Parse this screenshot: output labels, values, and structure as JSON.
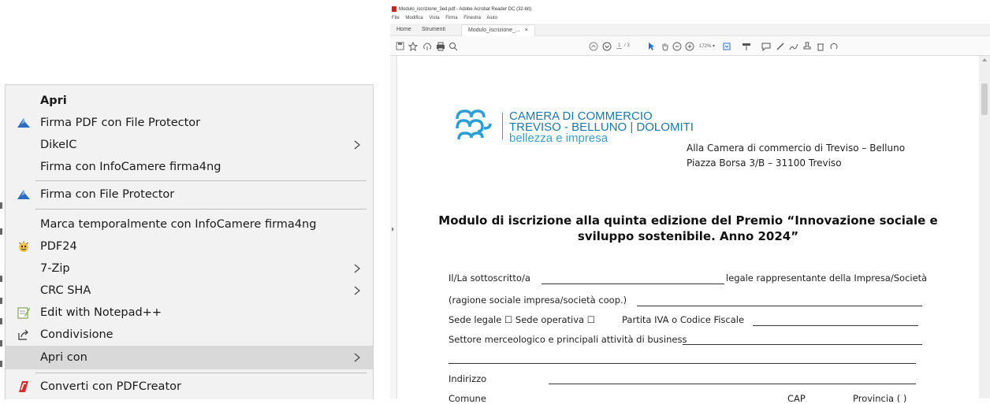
{
  "context_menu": {
    "items": [
      {
        "label": "Apri",
        "bold": true,
        "icon": null,
        "submenu": false
      },
      {
        "label": "Firma PDF con File Protector",
        "icon": "file-protector-icon",
        "submenu": false
      },
      {
        "label": "DikeIC",
        "icon": null,
        "submenu": true
      },
      {
        "label": "Firma con InfoCamere firma4ng",
        "icon": null,
        "submenu": false
      },
      {
        "label": "Firma con File Protector",
        "icon": "file-protector-icon",
        "submenu": false
      },
      {
        "label": "Marca temporalmente con InfoCamere firma4ng",
        "icon": null,
        "submenu": false
      },
      {
        "label": "PDF24",
        "icon": "pdf24-icon",
        "submenu": false
      },
      {
        "label": "7-Zip",
        "icon": null,
        "submenu": true
      },
      {
        "label": "CRC SHA",
        "icon": null,
        "submenu": true
      },
      {
        "label": "Edit with Notepad++",
        "icon": "notepad-plus-plus-icon",
        "submenu": false
      },
      {
        "label": "Condivisione",
        "icon": "share-icon",
        "submenu": false
      },
      {
        "label": "Apri con",
        "icon": null,
        "submenu": true,
        "highlighted": true
      },
      {
        "label": "Converti con PDFCreator",
        "icon": "pdfcreator-icon",
        "submenu": false
      }
    ]
  },
  "acrobat": {
    "title": "Modulo_iscrizione_3ed.pdf - Adobe Acrobat Reader DC (32-bit)",
    "menu": [
      "File",
      "Modifica",
      "Vista",
      "Firma",
      "Finestra",
      "Aiuto"
    ],
    "tabs": {
      "home": "Home",
      "tools": "Strumenti",
      "document": "Modulo_iscrizione_...",
      "close": "×"
    },
    "toolbar": {
      "page_current": "1",
      "page_total": "/ 3",
      "zoom": "172%"
    },
    "document": {
      "logo": {
        "line1": "CAMERA DI COMMERCIO",
        "line2": "TREVISO - BELLUNO | DOLOMITI",
        "line3": "bellezza e impresa"
      },
      "address": {
        "line1": "Alla Camera di commercio di Treviso – Belluno",
        "line2": "Piazza Borsa 3/B – 31100 Treviso"
      },
      "heading": {
        "line1": "Modulo di iscrizione alla quinta edizione del Premio “Innovazione sociale e",
        "line2": "sviluppo sostenibile. Anno 2024”"
      },
      "fields": {
        "sottoscritto": "Il/La sottoscritto/a",
        "legale": "legale rappresentante della Impresa/Società",
        "ragione": "(ragione sociale impresa/società coop.)",
        "sede": "Sede legale ☐ Sede operativa ☐",
        "piva": "Partita IVA o Codice Fiscale",
        "settore": "Settore merceologico e principali attività di business",
        "indirizzo": "Indirizzo",
        "comune": "Comune",
        "cap": "CAP",
        "provincia": "Provincia (      )"
      }
    }
  }
}
